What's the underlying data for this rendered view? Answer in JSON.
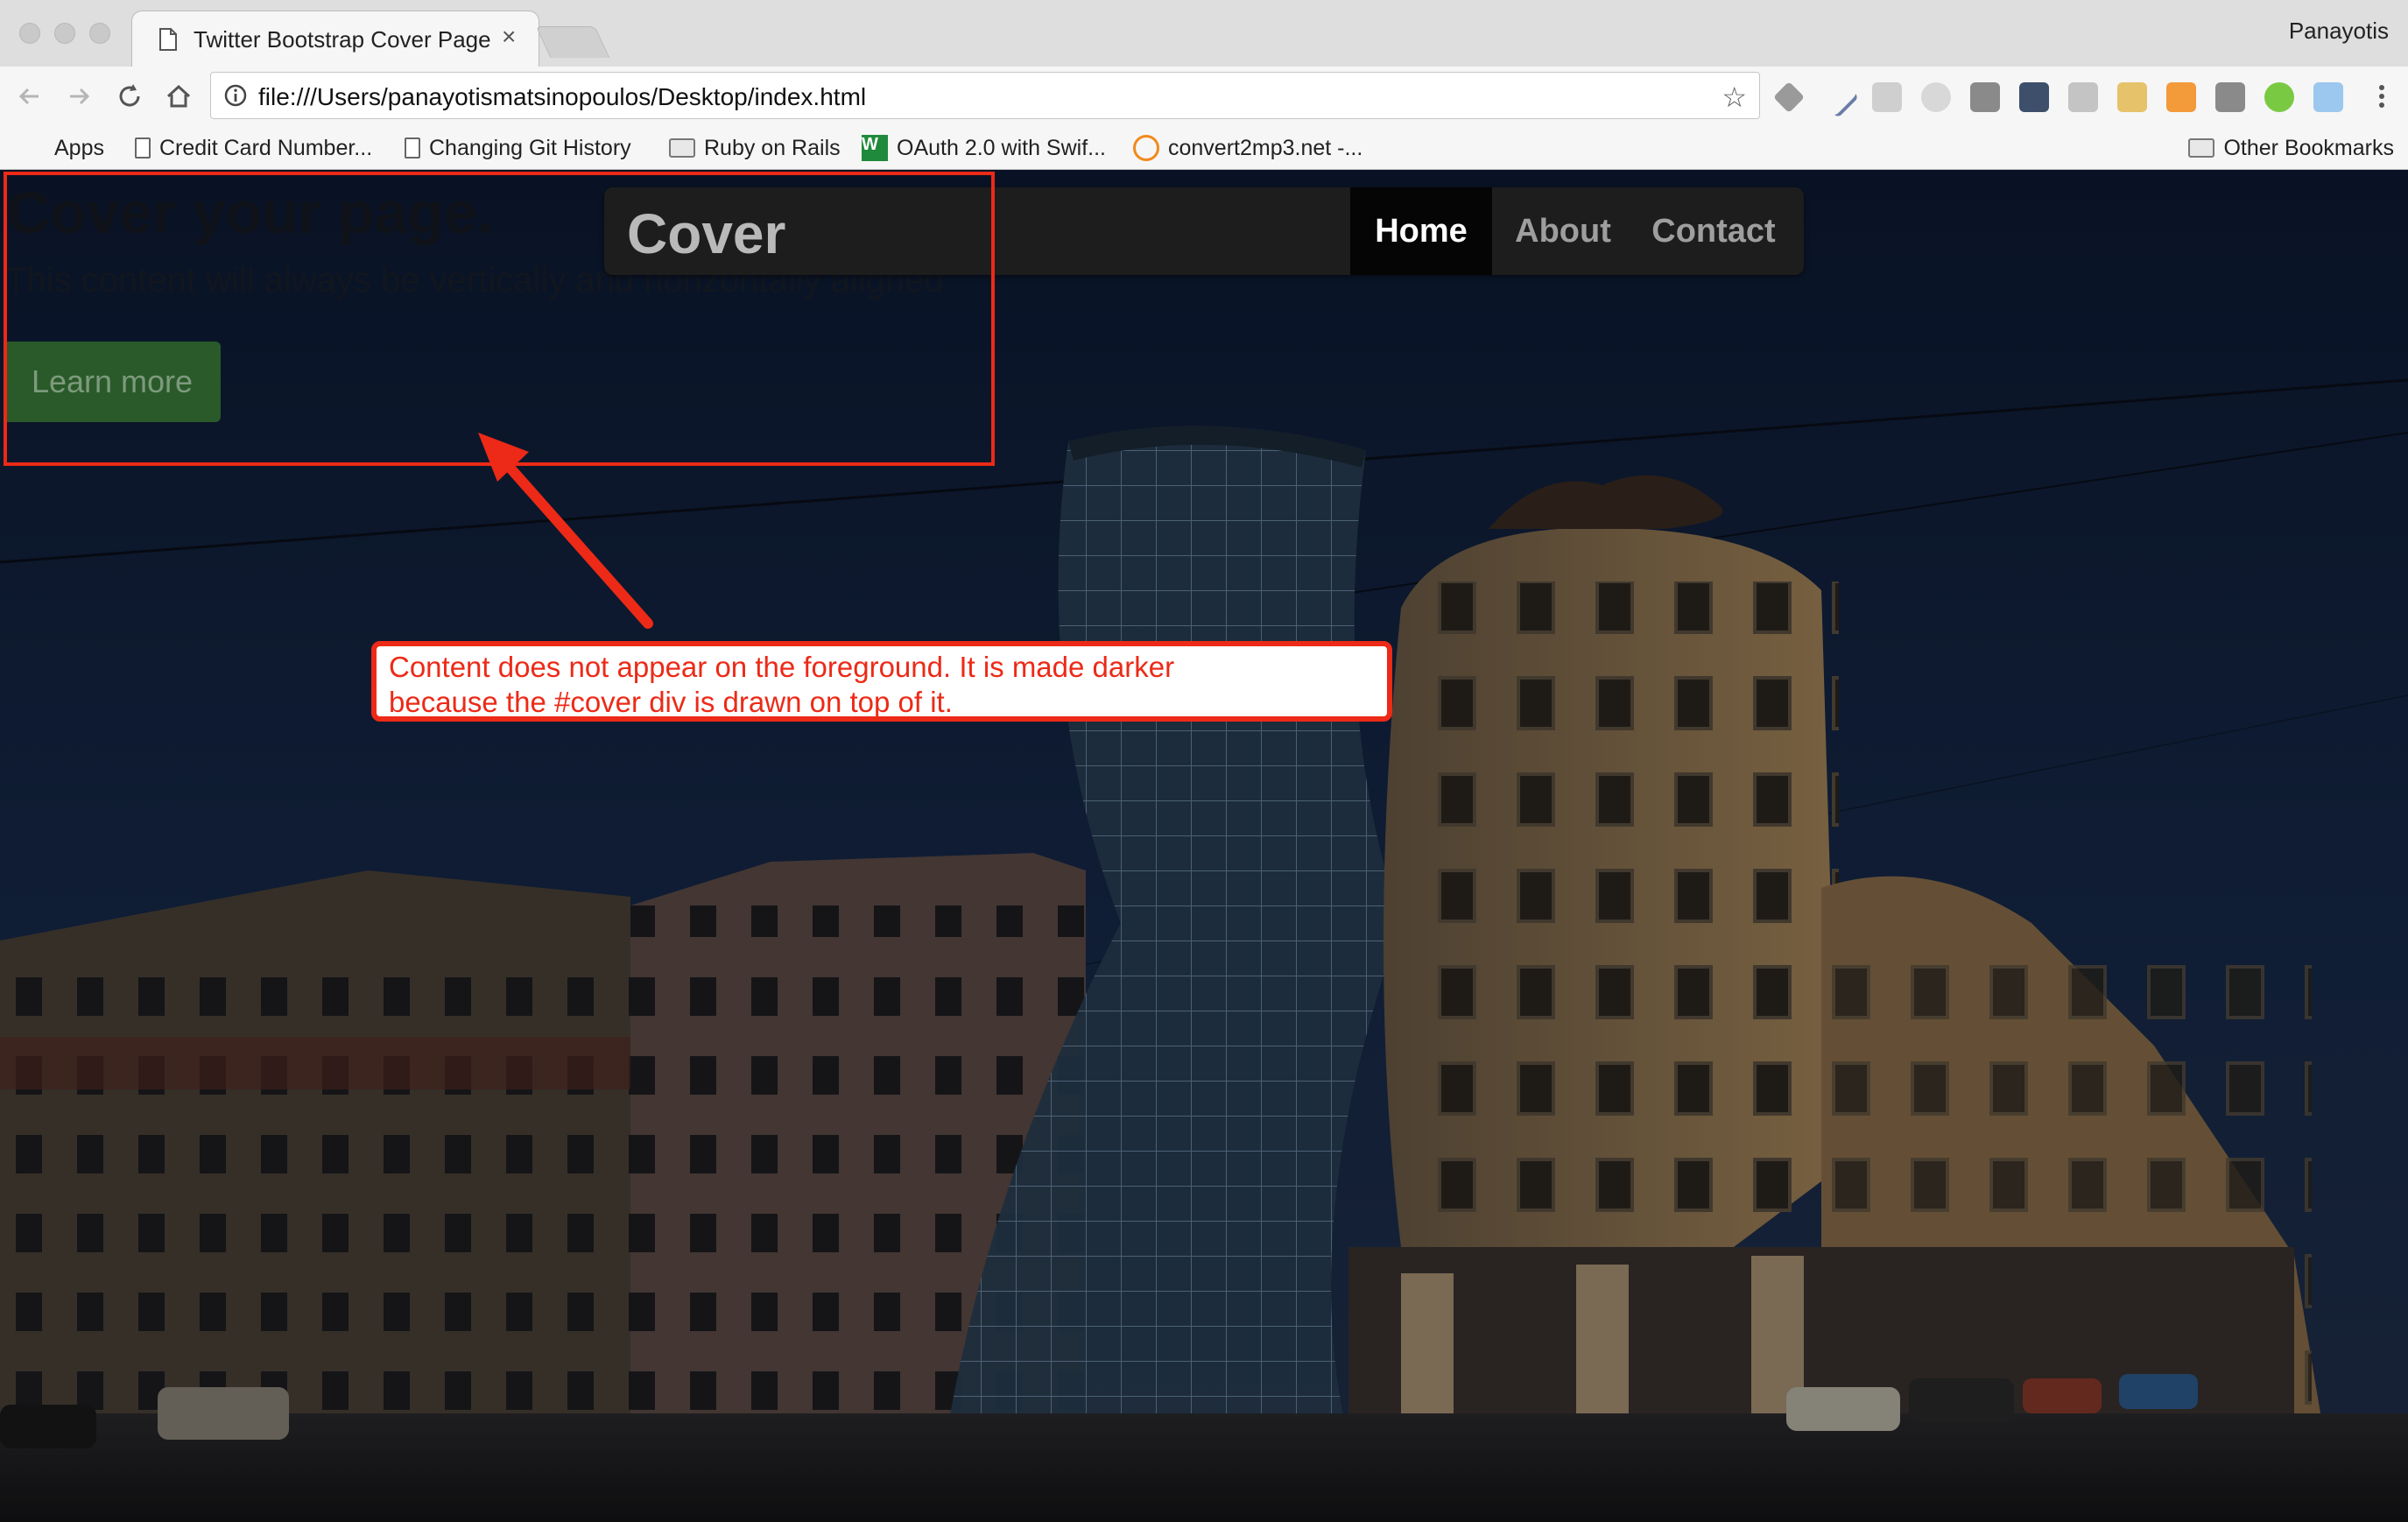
{
  "browser": {
    "tab_title": "Twitter Bootstrap Cover Page",
    "tab_close": "×",
    "profile": "Panayotis",
    "url": "file:///Users/panayotismatsinopoulos/Desktop/index.html",
    "star": "☆"
  },
  "bookmarks": {
    "items": [
      {
        "label": "Apps",
        "icon": "apps-grid-icon"
      },
      {
        "label": "Credit Card Number...",
        "icon": "page-icon"
      },
      {
        "label": "Changing Git History",
        "icon": "page-icon"
      },
      {
        "label": "Ruby on Rails",
        "icon": "folder-icon"
      },
      {
        "label": "OAuth 2.0 with Swif...",
        "icon": "green-w-icon"
      },
      {
        "label": "convert2mp3.net -...",
        "icon": "orange-ring-icon"
      }
    ],
    "other": "Other Bookmarks"
  },
  "page": {
    "heading": "Cover your page.",
    "lead": "This content will always be vertically and horizontally aligned",
    "button": "Learn more",
    "brand": "Cover",
    "nav": [
      {
        "label": "Home",
        "active": true
      },
      {
        "label": "About",
        "active": false
      },
      {
        "label": "Contact",
        "active": false
      }
    ]
  },
  "annotation": {
    "line1": "Content does not appear on the foreground. It is made darker",
    "line2": "because the #cover div is drawn on top of it."
  },
  "colors": {
    "annotation_red": "#ec2a17",
    "button_green": "#2a5a2a",
    "navbar_bg": "#1d1d1d",
    "sky_dark": "#0e1a33"
  }
}
